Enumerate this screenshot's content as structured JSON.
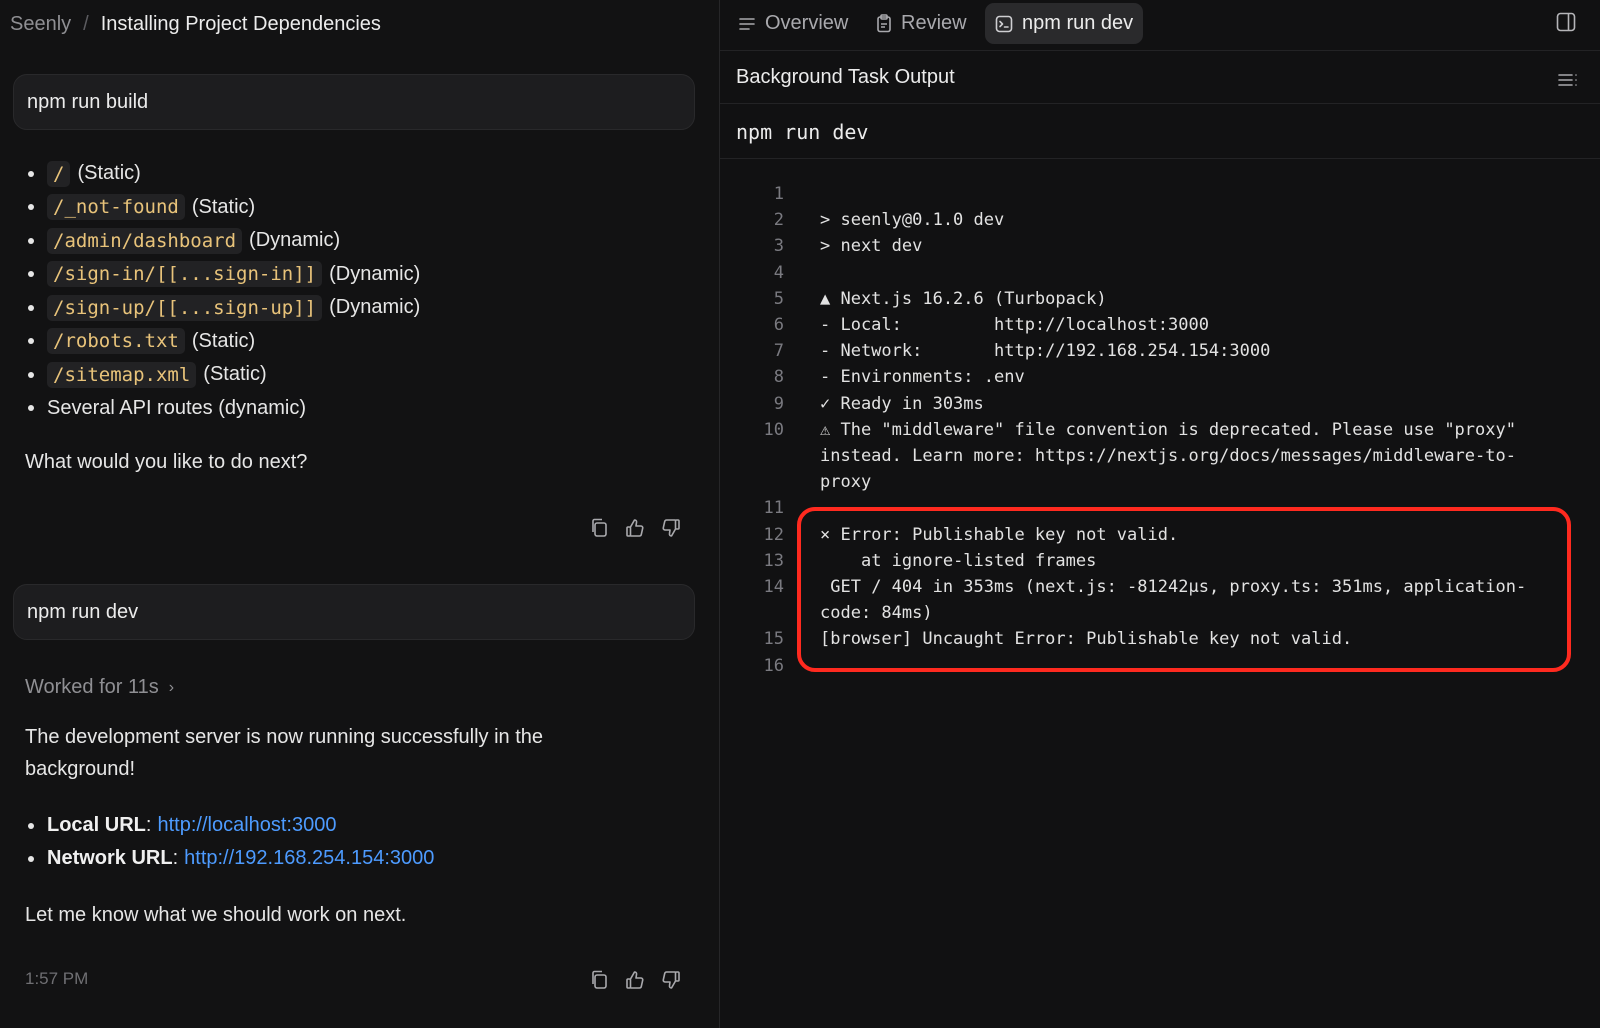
{
  "breadcrumb": {
    "app": "Seenly",
    "separator": "/",
    "title": "Installing Project Dependencies"
  },
  "chat": {
    "messages": [
      {
        "role": "user",
        "text": "npm run build"
      },
      {
        "role": "assistant",
        "routes": [
          {
            "path": "/",
            "kind": "(Static)"
          },
          {
            "path": "/_not-found",
            "kind": "(Static)"
          },
          {
            "path": "/admin/dashboard",
            "kind": "(Dynamic)"
          },
          {
            "path": "/sign-in/[[...sign-in]]",
            "kind": "(Dynamic)"
          },
          {
            "path": "/sign-up/[[...sign-up]]",
            "kind": "(Dynamic)"
          },
          {
            "path": "/robots.txt",
            "kind": "(Static)"
          },
          {
            "path": "/sitemap.xml",
            "kind": "(Static)"
          }
        ],
        "extra_item": "Several API routes (dynamic)",
        "closing": "What would you like to do next?"
      },
      {
        "role": "user",
        "text": "npm run dev"
      },
      {
        "role": "assistant",
        "worked_for": "Worked for 11s",
        "intro": "The development server is now running successfully in the background!",
        "urls": [
          {
            "label": "Local URL",
            "url": "http://localhost:3000"
          },
          {
            "label": "Network URL",
            "url": "http://192.168.254.154:3000"
          }
        ],
        "closing": "Let me know what we should work on next.",
        "time": "1:57 PM"
      }
    ]
  },
  "tabs": [
    {
      "label": "Overview",
      "icon": "list-icon"
    },
    {
      "label": "Review",
      "icon": "clipboard-icon"
    },
    {
      "label": "npm run dev",
      "icon": "terminal-icon",
      "active": true
    }
  ],
  "output": {
    "header": "Background Task Output",
    "command": "npm run dev",
    "lines": [
      {
        "n": "1",
        "text": ""
      },
      {
        "n": "2",
        "text": "> seenly@0.1.0 dev"
      },
      {
        "n": "3",
        "text": "> next dev"
      },
      {
        "n": "4",
        "text": ""
      },
      {
        "n": "5",
        "text": "▲ Next.js 16.2.6 (Turbopack)"
      },
      {
        "n": "6",
        "text": "- Local:         http://localhost:3000"
      },
      {
        "n": "7",
        "text": "- Network:       http://192.168.254.154:3000"
      },
      {
        "n": "8",
        "text": "- Environments: .env"
      },
      {
        "n": "9",
        "text": "✓ Ready in 303ms"
      },
      {
        "n": "10",
        "text": "⚠ The \"middleware\" file convention is deprecated. Please use \"proxy\" instead. Learn more: https://nextjs.org/docs/messages/middleware-to-proxy"
      },
      {
        "n": "11",
        "text": ""
      },
      {
        "n": "12",
        "text": "⨯ Error: Publishable key not valid."
      },
      {
        "n": "13",
        "text": "    at ignore-listed frames"
      },
      {
        "n": "14",
        "text": " GET / 404 in 353ms (next.js: -81242µs, proxy.ts: 351ms, application-code: 84ms)"
      },
      {
        "n": "15",
        "text": "[browser] Uncaught Error: Publishable key not valid."
      },
      {
        "n": "16",
        "text": ""
      }
    ]
  },
  "colors": {
    "link": "#4d9bff",
    "code": "#e8c37a",
    "highlight": "#ff2a1f"
  }
}
